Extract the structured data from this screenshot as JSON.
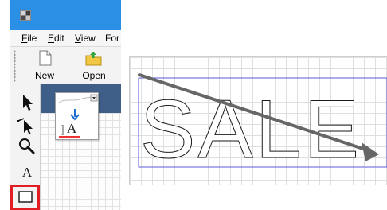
{
  "menu": {
    "file": "File",
    "edit": "Edit",
    "view": "View",
    "format": "For"
  },
  "toolbar": {
    "new_label": "New",
    "open_label": "Open"
  },
  "tools": [
    "select-tool",
    "node-edit-tool",
    "zoom-tool",
    "text-tool",
    "rectangle-tool"
  ],
  "text_tool_glyph": "A",
  "dropdown_glyph": "A",
  "canvas": {
    "text": "SALE"
  },
  "colors": {
    "titlebar": "#2b8fe6",
    "selection_highlight": "#e11e24",
    "bounding_box": "#5a5adf",
    "arrow": "#666666"
  }
}
